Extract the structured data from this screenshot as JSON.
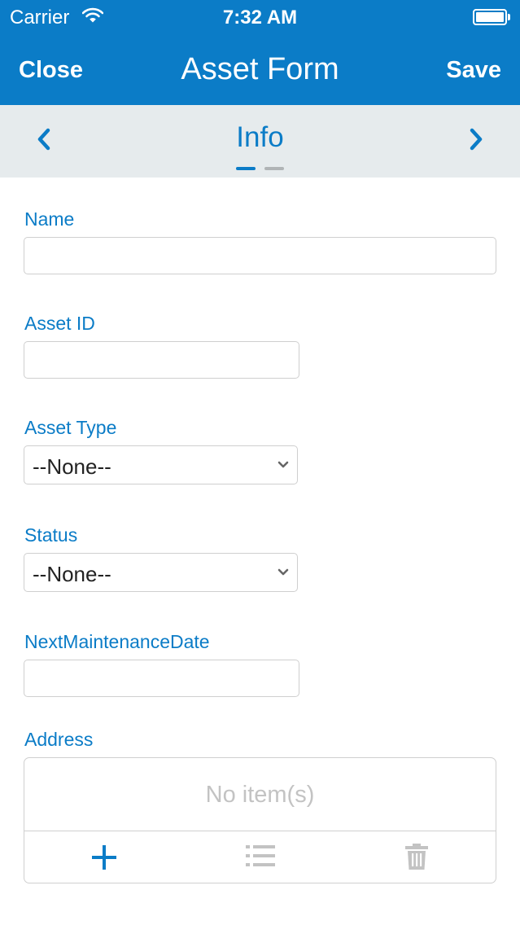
{
  "status_bar": {
    "carrier": "Carrier",
    "time": "7:32 AM"
  },
  "nav": {
    "close_label": "Close",
    "title": "Asset Form",
    "save_label": "Save"
  },
  "section": {
    "title": "Info",
    "page_count": 2,
    "active_page": 1
  },
  "form": {
    "name_label": "Name",
    "name_value": "",
    "asset_id_label": "Asset ID",
    "asset_id_value": "",
    "asset_type_label": "Asset Type",
    "asset_type_value": "--None--",
    "status_label": "Status",
    "status_value": "--None--",
    "next_maintenance_label": "NextMaintenanceDate",
    "next_maintenance_value": "",
    "address_label": "Address",
    "address_empty_text": "No item(s)"
  },
  "icons": {
    "wifi": "wifi-icon",
    "battery": "battery-icon",
    "prev": "chevron-left-icon",
    "next": "chevron-right-icon",
    "add": "plus-icon",
    "list": "list-icon",
    "delete": "trash-icon"
  },
  "colors": {
    "brand": "#0b7cc7",
    "section_bg": "#e6ebed",
    "border": "#cfcfcf",
    "muted": "#c3c3c3"
  }
}
